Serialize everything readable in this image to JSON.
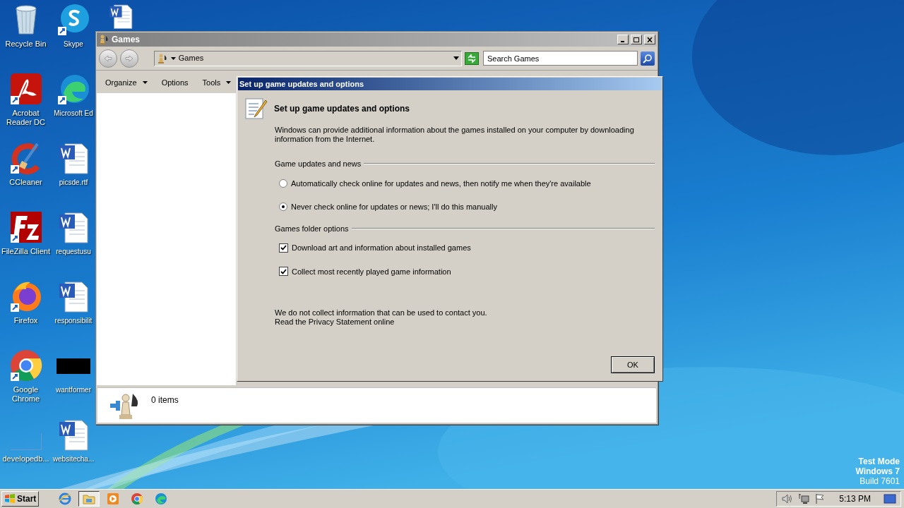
{
  "desktop": {
    "icons": [
      {
        "kind": "recycle",
        "label": "Recycle Bin"
      },
      {
        "kind": "acrobat",
        "label": "Acrobat Reader DC"
      },
      {
        "kind": "ccleaner",
        "label": "CCleaner"
      },
      {
        "kind": "filezilla",
        "label": "FileZilla Client"
      },
      {
        "kind": "firefox",
        "label": "Firefox"
      },
      {
        "kind": "chrome",
        "label": "Google Chrome"
      },
      {
        "kind": "blank",
        "label": "developedb..."
      },
      {
        "kind": "skype",
        "label": "Skype"
      },
      {
        "kind": "edge",
        "label": "Microsoft Ed"
      },
      {
        "kind": "word",
        "label": "picsde.rtf"
      },
      {
        "kind": "word",
        "label": "requestusu"
      },
      {
        "kind": "word",
        "label": "responsibilit"
      },
      {
        "kind": "redacted",
        "label": "wantformer"
      },
      {
        "kind": "word",
        "label": "websitecha..."
      },
      {
        "kind": "word"
      }
    ],
    "watermark": [
      "Test Mode",
      "Windows 7",
      "Build 7601"
    ]
  },
  "window": {
    "title": "Games",
    "address": "Games",
    "search": {
      "placeholder": "Search Games"
    },
    "toolbar": [
      {
        "label": "Organize",
        "dropdown": true
      },
      {
        "label": "Options",
        "dropdown": false
      },
      {
        "label": "Tools",
        "dropdown": true
      }
    ],
    "details": "0 items"
  },
  "dialog": {
    "title": "Set up game updates and options",
    "heading": "Set up game updates and options",
    "intro": "Windows can provide additional information about the games installed on your computer by downloading information from the Internet.",
    "groups": [
      {
        "title": "Game updates and news",
        "options": [
          {
            "kind": "radio",
            "label": "Automatically check online for updates and news, then notify me when they're available",
            "selected": false
          },
          {
            "kind": "radio",
            "label": "Never check online for updates or news; I'll do this manually",
            "selected": true
          }
        ]
      },
      {
        "title": "Games folder options",
        "options": [
          {
            "kind": "checkbox",
            "label": "Download art and information about installed games",
            "checked": true
          },
          {
            "kind": "checkbox",
            "label": "Collect most recently played game information",
            "checked": true
          }
        ]
      }
    ],
    "notes": [
      "We do not collect information that can be used to contact you.",
      "Read the Privacy Statement online"
    ],
    "ok": "OK"
  },
  "taskbar": {
    "start": "Start",
    "apps": [
      {
        "kind": "ie",
        "selected": false
      },
      {
        "kind": "explorer",
        "selected": true
      },
      {
        "kind": "media",
        "selected": false
      },
      {
        "kind": "chrome",
        "selected": false
      },
      {
        "kind": "edge",
        "selected": false
      }
    ],
    "clock": "5:13 PM"
  }
}
